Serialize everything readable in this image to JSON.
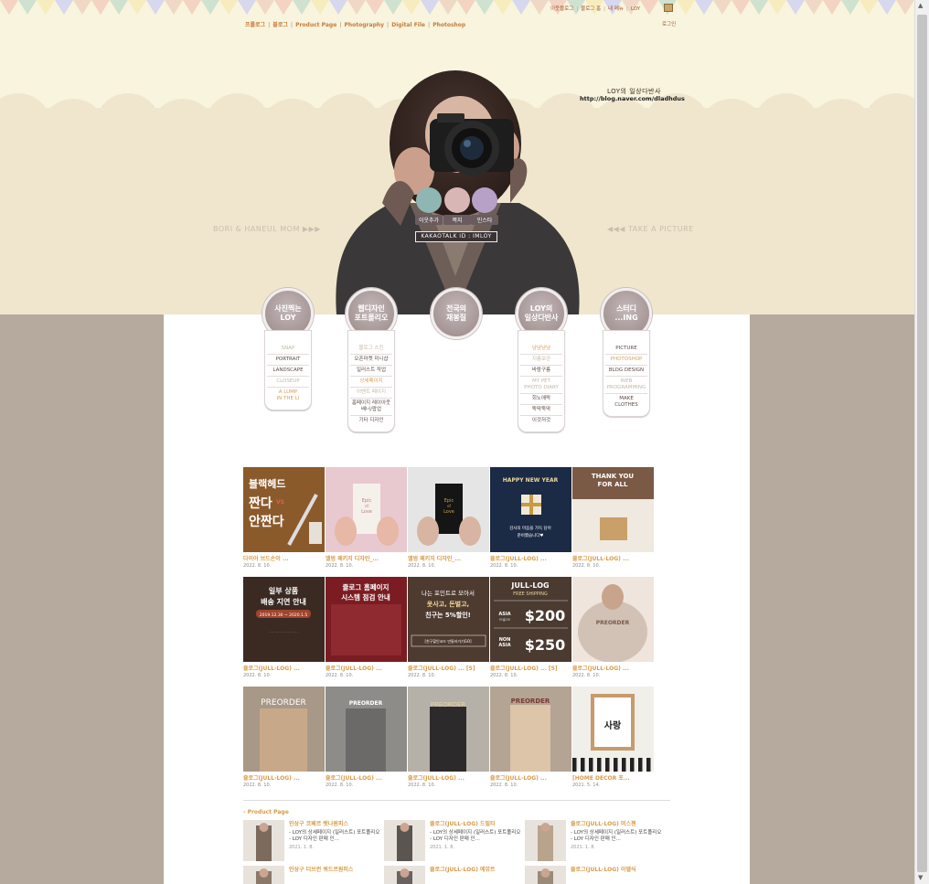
{
  "topnav": [
    "프롤로그",
    "블로그",
    "Product Page",
    "Photography",
    "Digital File",
    "Photoshop"
  ],
  "topmenu": [
    "이웃블로그",
    "블로그 홈",
    "내 메뉴",
    "LOY"
  ],
  "login_label": "로그인",
  "blog": {
    "title": "LOY의 일상다반사",
    "url": "http://blog.naver.com/dladhdus"
  },
  "taglines": {
    "left": "BORI & HANEUL MOM ▶▶▶",
    "right": "◀◀◀ TAKE A PICTURE"
  },
  "sns": [
    {
      "label": "이웃추가",
      "color": "#8fb6b2",
      "icon": "neighbor-add-icon"
    },
    {
      "label": "쪽지",
      "color": "#d9b6b6",
      "icon": "mail-icon"
    },
    {
      "label": "인스타",
      "color": "#b8a1c6",
      "icon": "instagram-icon"
    }
  ],
  "kakao": "KAKAOTALK ID : IMLOY",
  "categories": [
    {
      "title": "사진찍는\nLOY",
      "items": [
        [
          "SNAP",
          "mute"
        ],
        [
          "PORTRAIT",
          ""
        ],
        [
          "LANDSCAPE",
          ""
        ],
        [
          "CLOSEUP",
          "mute"
        ],
        [
          "A LUMP\nIN THE LI",
          "hl"
        ]
      ]
    },
    {
      "title": "웹디자인\n포트폴리오",
      "items": [
        [
          "블로그 스킨",
          "mute"
        ],
        [
          "오픈마켓 미니샵",
          ""
        ],
        [
          "일러스트 작업",
          ""
        ],
        [
          "상세페이지",
          "hl"
        ],
        [
          "이벤트 페이지",
          "mute"
        ],
        [
          "홈페이지 레이아웃\n배너/팝업",
          ""
        ],
        [
          "기타 디자인",
          ""
        ]
      ]
    },
    {
      "title": "전국의\n재봉질",
      "items": []
    },
    {
      "title": "LOY의\n일상다반사",
      "items": [
        [
          "냠냠냠냠",
          "hl"
        ],
        [
          "지름보관",
          "mute"
        ],
        [
          "바람구름",
          ""
        ],
        [
          "MY PET\nPHOTO DIARY",
          "mute"
        ],
        [
          "회노애락",
          ""
        ],
        [
          "뚝딱뚝딱",
          ""
        ],
        [
          "이것저것",
          ""
        ]
      ]
    },
    {
      "title": "스터디\n...ING",
      "items": [
        [
          "PICTURE",
          ""
        ],
        [
          "PHOTOSHOP",
          "hl"
        ],
        [
          "BLOG DESIGN",
          ""
        ],
        [
          "WEB\nPROGRAMMING",
          "mute"
        ],
        [
          "MAKE\nCLOTHES",
          ""
        ]
      ]
    }
  ],
  "posts": [
    {
      "title": "다이어 브드손이 ...",
      "date": "2022. 8. 10.",
      "art": "shave"
    },
    {
      "title": "앨범 패키지 디자인_...",
      "date": "2022. 8. 10.",
      "art": "pinkbook"
    },
    {
      "title": "앨범 패키지 디자인_...",
      "date": "2022. 8. 10.",
      "art": "blackbook"
    },
    {
      "title": "쥴로그(JULL-LOG) ...",
      "date": "2022. 8. 10.",
      "art": "newyear"
    },
    {
      "title": "쥴로그(JULL-LOG) ...",
      "date": "2022. 8. 10.",
      "art": "thanks"
    },
    {
      "title": "쥴로그(JULL-LOG) ...",
      "date": "2022. 8. 10.",
      "art": "delay"
    },
    {
      "title": "쥴로그(JULL-LOG) ...",
      "date": "2022. 8. 10.",
      "art": "check"
    },
    {
      "title": "쥴로그(JULL-LOG) ... [5]",
      "date": "2022. 8. 10.",
      "art": "point"
    },
    {
      "title": "쥴로그(JULL-LOG) ... [5]",
      "date": "2022. 8. 10.",
      "art": "ship"
    },
    {
      "title": "쥴로그(JULL-LOG) ...",
      "date": "2022. 8. 10.",
      "art": "fur"
    },
    {
      "title": "쥴로그(JULL-LOG) ...",
      "date": "2022. 8. 10.",
      "art": "coat1"
    },
    {
      "title": "쥴로그(JULL-LOG) ...",
      "date": "2022. 8. 10.",
      "art": "coat2"
    },
    {
      "title": "쥴로그(JULL-LOG) ...",
      "date": "2022. 8. 10.",
      "art": "coat3"
    },
    {
      "title": "쥴로그(JULL-LOG) ...",
      "date": "2022. 8. 10.",
      "art": "coat4"
    },
    {
      "title": "[HOME DECOR 포...",
      "date": "2021. 5. 14.",
      "art": "frame"
    }
  ],
  "thumb_texts": {
    "shave": [
      "블랙헤드",
      "짠다",
      "안짠다",
      "VS"
    ],
    "newyear": [
      "HAPPY NEW YEAR",
      "감사의 마음을 가득 담아",
      "준비했습니다♥"
    ],
    "thanks": [
      "THANK YOU",
      "FOR ALL"
    ],
    "delay": [
      "일부 상품",
      "배송 지연 안내",
      "2019.12.30 ~ 2020.1.5"
    ],
    "check": [
      "쥴로그 홈페이지",
      "시스템 점검 안내"
    ],
    "point": [
      "나는 포인트로 모아서",
      "옷사고, 돈벌고,",
      "친구는 5%할인!",
      "[친구할인코드 만들러가기GO]"
    ],
    "ship": [
      "JULL-LOG",
      "FREE SHIPPING",
      "ASIA",
      "region",
      "$200",
      "NON",
      "ASIA",
      "$250"
    ],
    "fur": [
      "PREORDER"
    ],
    "coat1": [
      "PREORDER"
    ],
    "coat2": [
      "PREORDER"
    ],
    "coat3": [
      "PREORDER"
    ],
    "coat4": [
      "PREORDER"
    ],
    "frame": [
      "사랑"
    ],
    "pinkbook": [
      "Epic",
      "of",
      "Love"
    ],
    "blackbook": [
      "Epic",
      "of",
      "Love"
    ]
  },
  "product_page": {
    "heading": "- Product Page",
    "items": [
      {
        "title": "인상구 코페르 렛나원피스",
        "desc": "- LOY의 상세페이지 (일러스트) 포트폴리오 - LOY 디자인 판매 인...",
        "date": "2021. 1. 8."
      },
      {
        "title": "쥴로그(JULL-LOG) 드빌티",
        "desc": "- LOY의 상세페이지 (일러스트) 포트폴리오 - LOY 디자인 판매 인...",
        "date": "2021. 1. 8."
      },
      {
        "title": "쥴로그(JULL-LOG) 머스첸",
        "desc": "- LOY의 상세페이지 (일러스트) 포트폴리오 - LOY 디자인 판매 인...",
        "date": "2021. 1. 8."
      },
      {
        "title": "인상구 더브런 쿼드르원피스",
        "desc": "",
        "date": ""
      },
      {
        "title": "쥴로그(JULL-LOG) 에뮤트",
        "desc": "",
        "date": ""
      },
      {
        "title": "쥴로그(JULL-LOG) 아델식",
        "desc": "",
        "date": ""
      }
    ]
  }
}
